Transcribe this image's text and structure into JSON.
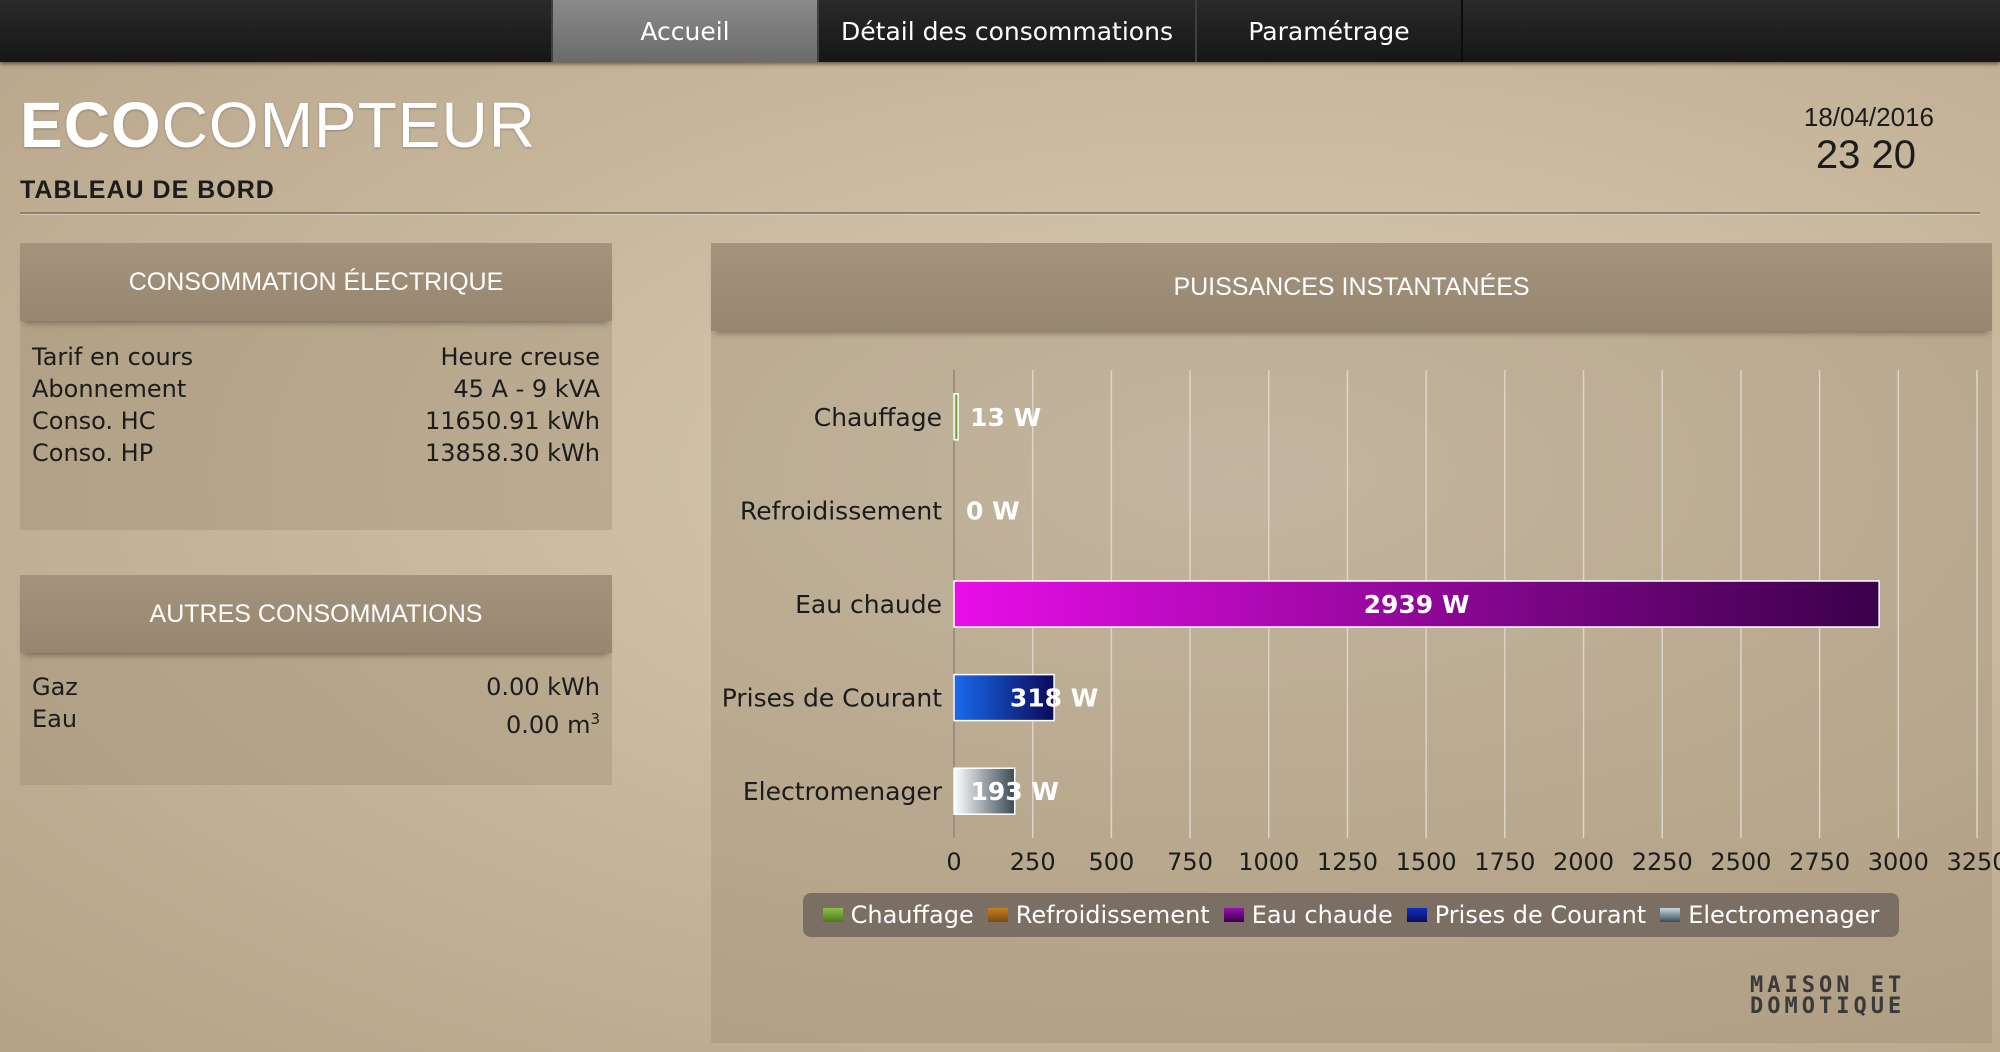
{
  "nav": {
    "tabs": [
      {
        "label": "Accueil"
      },
      {
        "label": "Détail des consommations"
      },
      {
        "label": "Paramétrage"
      }
    ]
  },
  "header": {
    "brand_bold": "ECO",
    "brand_rest": "COMPTEUR",
    "subtitle": "TABLEAU DE BORD",
    "date": "18/04/2016",
    "time": "23 20"
  },
  "elec": {
    "title": "CONSOMMATION ÉLECTRIQUE",
    "rows": [
      {
        "label": "Tarif en cours",
        "value": "Heure creuse"
      },
      {
        "label": "Abonnement",
        "value": "45 A - 9 kVA"
      },
      {
        "label": "Conso. HC",
        "value": "11650.91 kWh"
      },
      {
        "label": "Conso. HP",
        "value": "13858.30 kWh"
      }
    ]
  },
  "autres": {
    "title": "AUTRES CONSOMMATIONS",
    "rows": [
      {
        "label": "Gaz",
        "value": "0.00 kWh"
      },
      {
        "label": "Eau",
        "value": "0.00 m",
        "sup": "3"
      }
    ]
  },
  "chart_panel": {
    "title": "PUISSANCES INSTANTANÉES"
  },
  "chart_data": {
    "type": "bar",
    "orientation": "horizontal",
    "categories": [
      "Chauffage",
      "Refroidissement",
      "Eau chaude",
      "Prises de Courant",
      "Electromenager"
    ],
    "values": [
      13,
      0,
      2939,
      318,
      193
    ],
    "value_labels": [
      "13 W",
      "0 W",
      "2939 W",
      "318 W",
      "193 W"
    ],
    "xlim": [
      0,
      3250
    ],
    "xticks": [
      "0",
      "250",
      "500",
      "750",
      "1000",
      "1250",
      "1500",
      "1750",
      "2000",
      "2250",
      "2500",
      "2750",
      "3000",
      "3250"
    ],
    "grid": true,
    "colors": [
      [
        "#b8e07a",
        "#4a7a1a"
      ],
      [
        "#e0a040",
        "#7a4a10"
      ],
      [
        "#e80ee8",
        "#3a004a"
      ],
      [
        "#1a6aee",
        "#0a0a5a"
      ],
      [
        "#ffffff",
        "#3a4a56"
      ]
    ],
    "legend": {
      "position": "bottom",
      "entries": [
        "Chauffage",
        "Refroidissement",
        "Eau chaude",
        "Prises de Courant",
        "Electromenager"
      ],
      "colors": [
        "#8fc04a",
        "#c8801e",
        "#9a10b0",
        "#1030c0",
        "#c8d8e0"
      ]
    }
  },
  "logo": {
    "line1": "MAISON ET",
    "line2": "DOMOTIQUE"
  }
}
